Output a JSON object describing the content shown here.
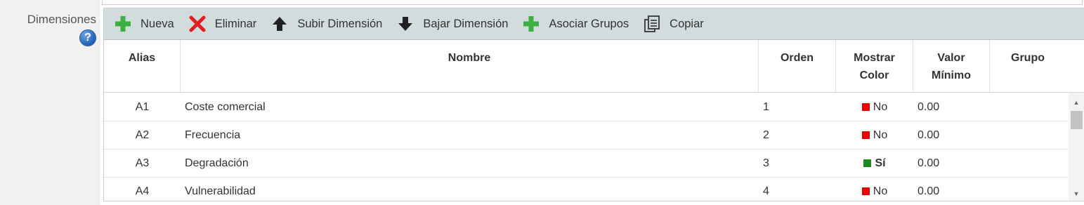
{
  "field": {
    "label": "Dimensiones",
    "help_icon": "?"
  },
  "toolbar": {
    "buttons": [
      {
        "label": "Nueva",
        "icon": "plus-icon"
      },
      {
        "label": "Eliminar",
        "icon": "x-icon"
      },
      {
        "label": "Subir Dimensión",
        "icon": "arrow-up-icon"
      },
      {
        "label": "Bajar Dimensión",
        "icon": "arrow-down-icon"
      },
      {
        "label": "Asociar Grupos",
        "icon": "plus-icon"
      },
      {
        "label": "Copiar",
        "icon": "copy-icon"
      }
    ]
  },
  "columns": [
    "Alias",
    "Nombre",
    "Orden",
    "Mostrar Color",
    "Valor Mínimo",
    "Grupo"
  ],
  "rows": [
    {
      "alias": "A1",
      "nombre": "Coste comercial",
      "orden": "1",
      "mostrar_color": "No",
      "valor_minimo": "0.00",
      "grupo": ""
    },
    {
      "alias": "A2",
      "nombre": "Frecuencia",
      "orden": "2",
      "mostrar_color": "No",
      "valor_minimo": "0.00",
      "grupo": ""
    },
    {
      "alias": "A3",
      "nombre": "Degradación",
      "orden": "3",
      "mostrar_color": "Sí",
      "valor_minimo": "0.00",
      "grupo": ""
    },
    {
      "alias": "A4",
      "nombre": "Vulnerabilidad",
      "orden": "4",
      "mostrar_color": "No",
      "valor_minimo": "0.00",
      "grupo": ""
    }
  ],
  "colors": {
    "no": "#ee0000",
    "yes": "#1e8a1e",
    "plus": "#3cb043",
    "x": "#e02020",
    "toolbar_bg": "#d3dcdd"
  }
}
